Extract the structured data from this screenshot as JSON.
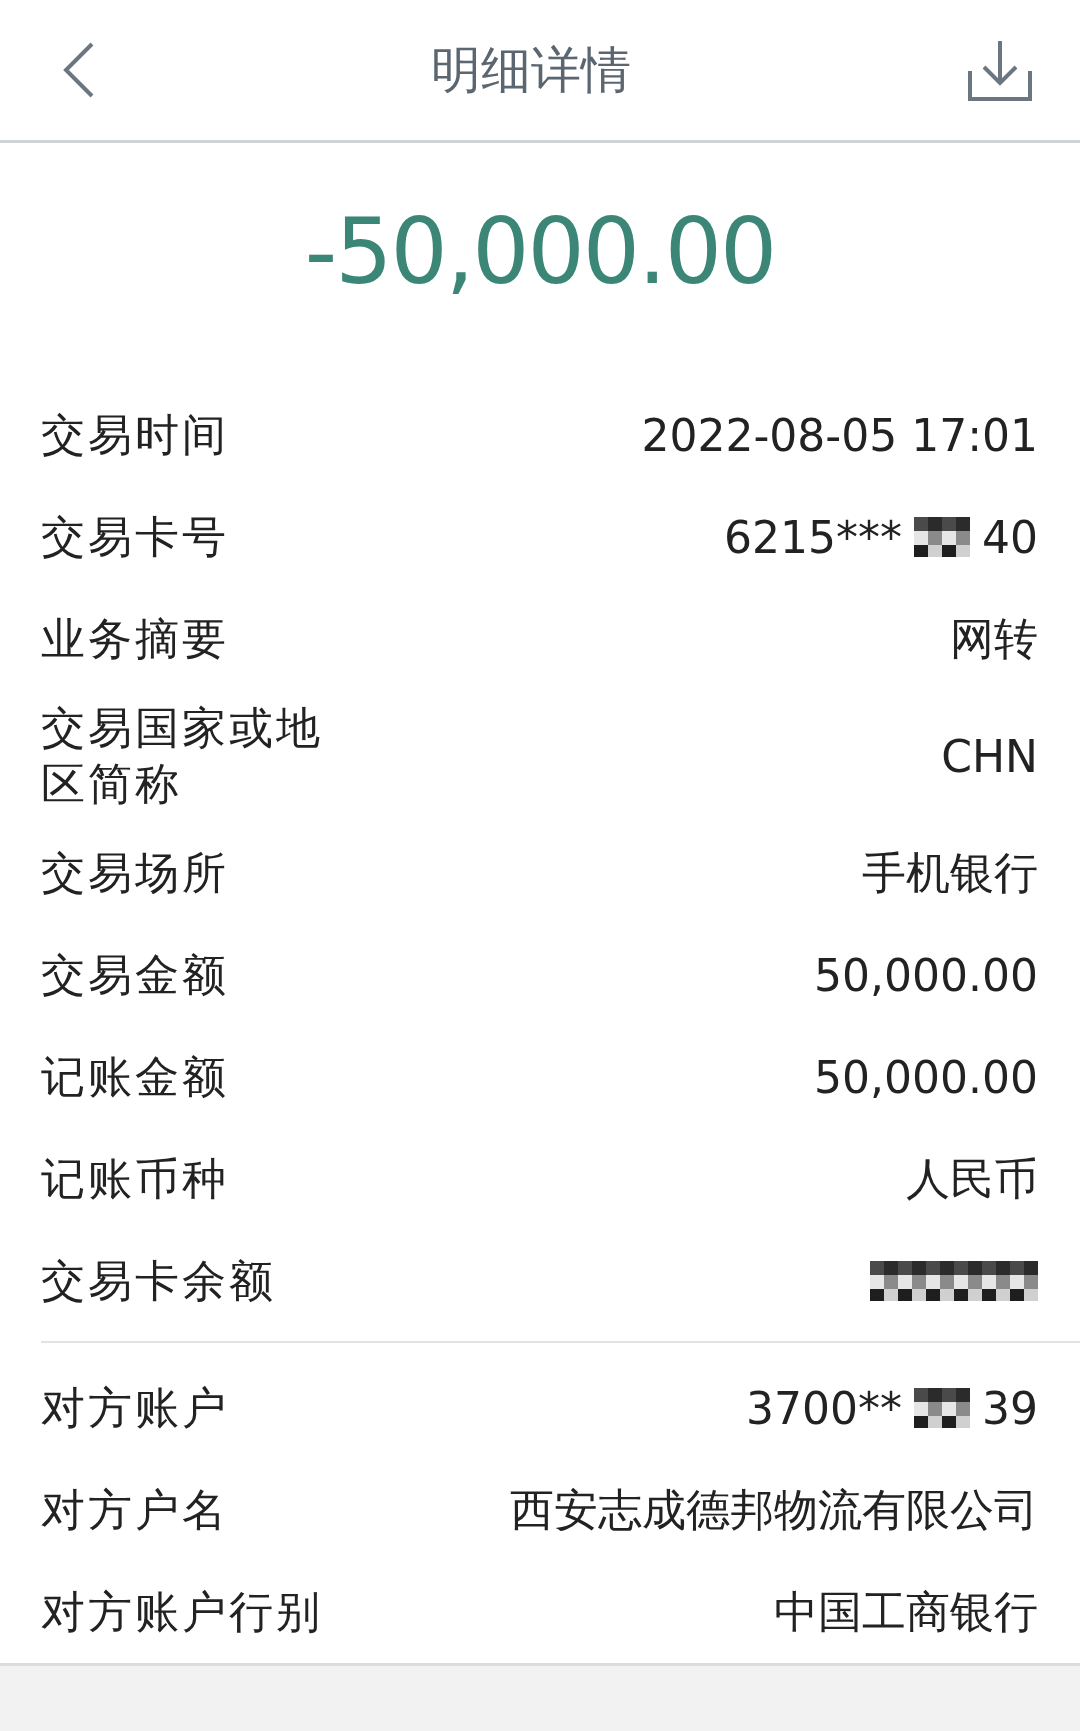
{
  "header": {
    "title": "明细详情"
  },
  "amount": "-50,000.00",
  "details": [
    {
      "label": "交易时间",
      "value": "2022-08-05 17:01"
    },
    {
      "label": "交易卡号",
      "kind": "masked",
      "value_start": "6215***",
      "value_end": "40"
    },
    {
      "label": "业务摘要",
      "value": "网转"
    },
    {
      "label": "交易国家或地区简称",
      "value": "CHN"
    },
    {
      "label": "交易场所",
      "value": "手机银行"
    },
    {
      "label": "交易金额",
      "value": "50,000.00"
    },
    {
      "label": "记账金额",
      "value": "50,000.00"
    },
    {
      "label": "记账币种",
      "value": "人民币"
    },
    {
      "label": "交易卡余额",
      "kind": "masked"
    }
  ],
  "counterparty": [
    {
      "label": "对方账户",
      "kind": "masked",
      "value_start": "3700**",
      "value_end": "39"
    },
    {
      "label": "对方户名",
      "value": "西安志成德邦物流有限公司"
    },
    {
      "label": "对方账户行别",
      "value": "中国工商银行"
    }
  ]
}
